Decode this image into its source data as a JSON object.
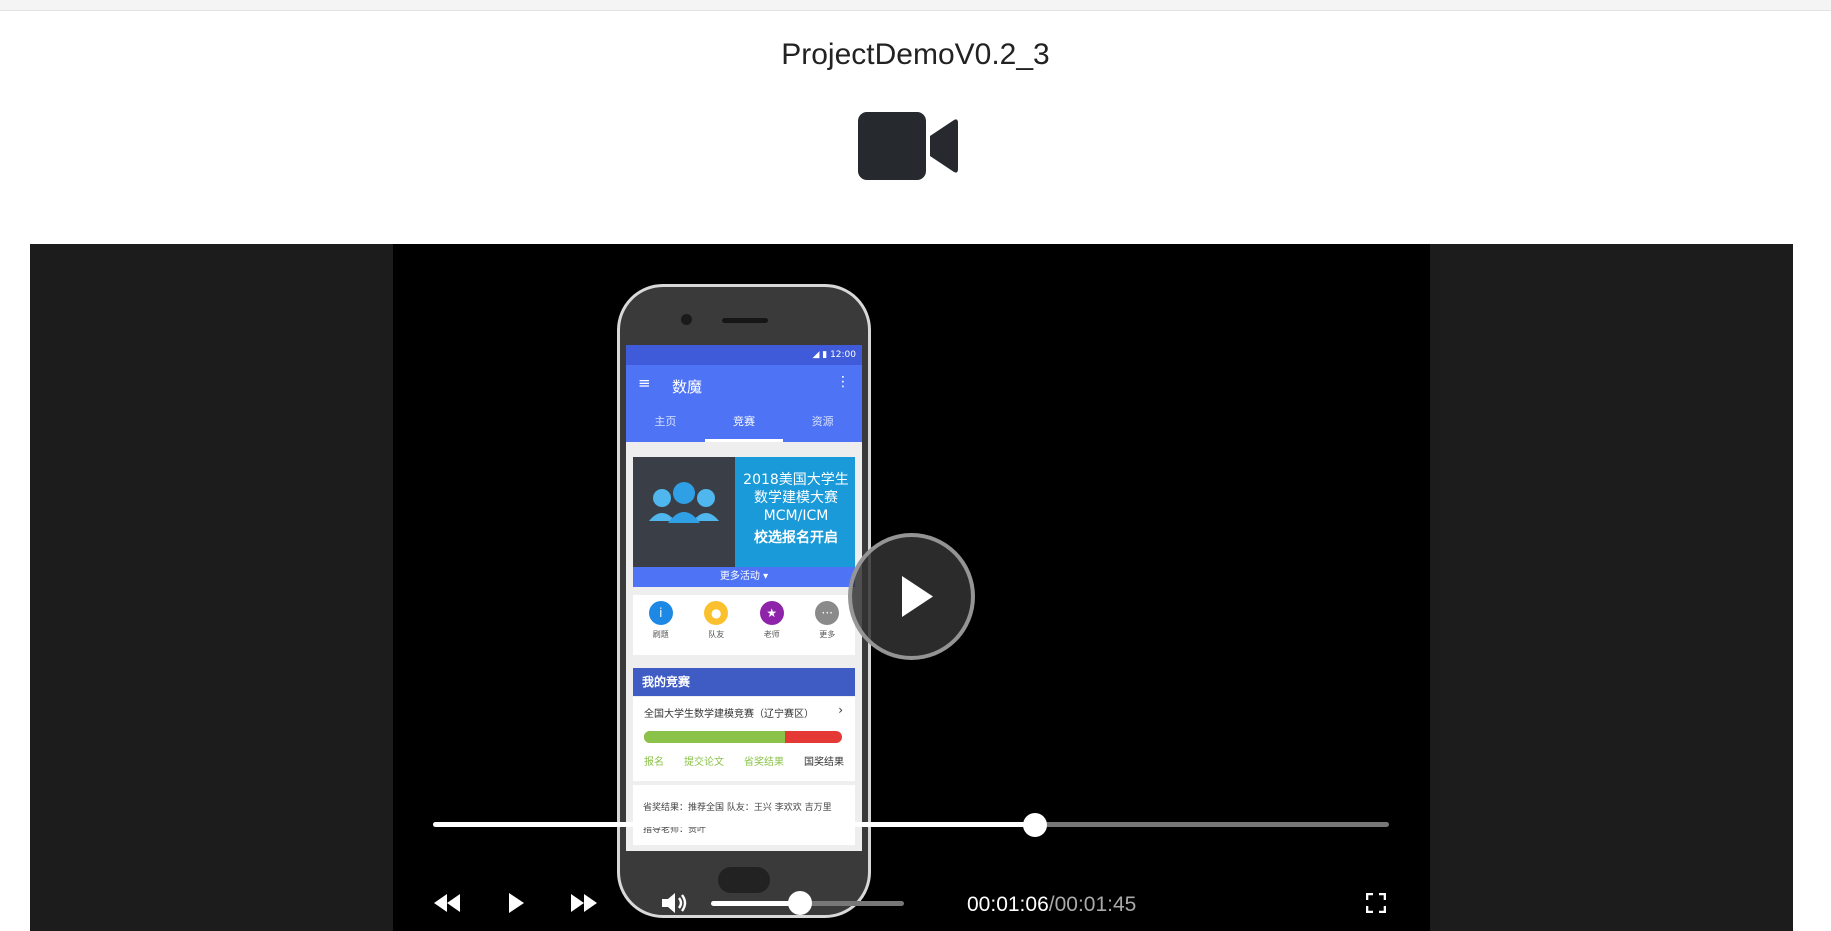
{
  "page": {
    "title": "ProjectDemoV0.2_3"
  },
  "icons": {
    "header": "video-camera-icon",
    "rewind": "rewind-icon",
    "play": "play-icon",
    "forward": "fast-forward-icon",
    "volume": "volume-icon",
    "fullscreen": "fullscreen-icon"
  },
  "player": {
    "current_time": "00:01:06",
    "separator": "/",
    "duration": "00:01:45",
    "progress": 0.63,
    "volume": 0.46
  },
  "phone_app": {
    "status_time": "12:00",
    "menu_glyph": "≡",
    "app_title": "数魔",
    "more_glyph": "⋮",
    "tabs": [
      {
        "label": "主页",
        "active": false
      },
      {
        "label": "竞赛",
        "active": true
      },
      {
        "label": "资源",
        "active": false
      }
    ],
    "banner": {
      "line1": "2018美国大学生",
      "line2": "数学建模大赛",
      "line3": "MCM/ICM",
      "line4": "校选报名开启"
    },
    "more_activities": "更多活动 ▾",
    "cards": [
      {
        "label": "刷题",
        "glyph": "i",
        "color": "#1e88e5"
      },
      {
        "label": "队友",
        "glyph": "●",
        "color": "#fbc02d"
      },
      {
        "label": "老师",
        "glyph": "★",
        "color": "#8e24aa"
      },
      {
        "label": "更多",
        "glyph": "···",
        "color": "#8a8a8a"
      }
    ],
    "section_title": "我的竞赛",
    "competition": {
      "name": "全国大学生数学建模竞赛（辽宁赛区）",
      "chevron": "›",
      "progress": 0.71,
      "steps": [
        "报名",
        "提交论文",
        "省奖结果",
        "国奖结果"
      ]
    },
    "info_line1": "省奖结果：推荐全国   队友：王兴   李欢欢   吉万里",
    "info_line2": "指导老师：贵叶"
  }
}
